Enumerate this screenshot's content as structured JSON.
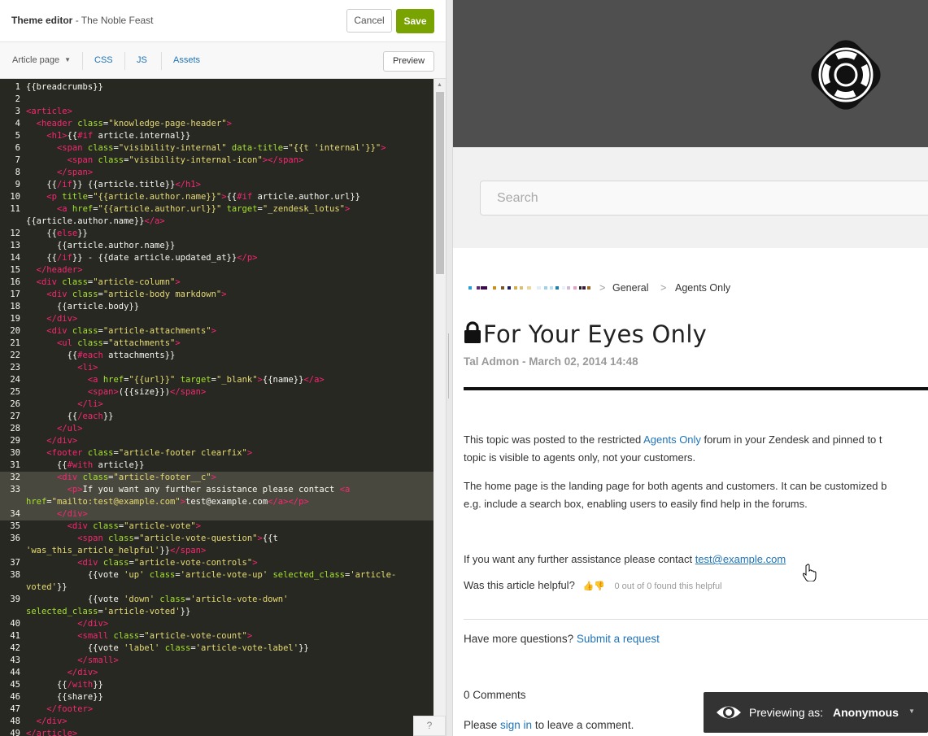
{
  "editor": {
    "title": "Theme editor",
    "subtitle": " - The Noble Feast",
    "cancel_label": "Cancel",
    "save_label": "Save",
    "save_color": "#78a300",
    "page_selector": "Article page",
    "tabs": [
      "CSS",
      "JS",
      "Assets"
    ],
    "preview_label": "Preview",
    "help_label": "?",
    "code_lines": [
      {
        "n": "1",
        "html": "<span class='v'>{{breadcrumbs}}</span>"
      },
      {
        "n": "2",
        "html": ""
      },
      {
        "n": "3",
        "html": "<span class='t'>&lt;article&gt;</span>"
      },
      {
        "n": "4",
        "html": "  <span class='t'>&lt;header</span> <span class='a'>class</span>=<span class='s'>\"knowledge-page-header\"</span><span class='t'>&gt;</span>"
      },
      {
        "n": "5",
        "html": "    <span class='t'>&lt;h1&gt;</span>{{<span class='t'>#if</span> article.internal}}"
      },
      {
        "n": "6",
        "html": "      <span class='t'>&lt;span</span> <span class='a'>class</span>=<span class='s'>\"visibility-internal\"</span> <span class='a'>data-title</span>=<span class='s'>\"{{t 'internal'}}\"</span><span class='t'>&gt;</span>"
      },
      {
        "n": "7",
        "html": "        <span class='t'>&lt;span</span> <span class='a'>class</span>=<span class='s'>\"visibility-internal-icon\"</span><span class='t'>&gt;&lt;/span&gt;</span>"
      },
      {
        "n": "8",
        "html": "      <span class='t'>&lt;/span&gt;</span>"
      },
      {
        "n": "9",
        "html": "    {{<span class='t'>/if</span>}} {{article.title}}<span class='t'>&lt;/h1&gt;</span>"
      },
      {
        "n": "10",
        "html": "    <span class='t'>&lt;p</span> <span class='a'>title</span>=<span class='s'>\"{{article.author.name}}\"</span><span class='t'>&gt;</span>{{<span class='t'>#if</span> article.author.url}}"
      },
      {
        "n": "11",
        "html": "      <span class='t'>&lt;a</span> <span class='a'>href</span>=<span class='s'>\"{{article.author.url}}\"</span> <span class='a'>target</span>=<span class='s'>\"_zendesk_lotus\"</span><span class='t'>&gt;</span>"
      },
      {
        "n": "",
        "html": "{{article.author.name}}<span class='t'>&lt;/a&gt;</span>"
      },
      {
        "n": "12",
        "html": "    {{<span class='t'>else</span>}}"
      },
      {
        "n": "13",
        "html": "      {{article.author.name}}"
      },
      {
        "n": "14",
        "html": "    {{<span class='t'>/if</span>}} - {{date article.updated_at}}<span class='t'>&lt;/p&gt;</span>"
      },
      {
        "n": "15",
        "html": "  <span class='t'>&lt;/header&gt;</span>"
      },
      {
        "n": "16",
        "html": "  <span class='t'>&lt;div</span> <span class='a'>class</span>=<span class='s'>\"article-column\"</span><span class='t'>&gt;</span>"
      },
      {
        "n": "17",
        "html": "    <span class='t'>&lt;div</span> <span class='a'>class</span>=<span class='s'>\"article-body markdown\"</span><span class='t'>&gt;</span>"
      },
      {
        "n": "18",
        "html": "      {{article.body}}"
      },
      {
        "n": "19",
        "html": "    <span class='t'>&lt;/div&gt;</span>"
      },
      {
        "n": "20",
        "html": "    <span class='t'>&lt;div</span> <span class='a'>class</span>=<span class='s'>\"article-attachments\"</span><span class='t'>&gt;</span>"
      },
      {
        "n": "21",
        "html": "      <span class='t'>&lt;ul</span> <span class='a'>class</span>=<span class='s'>\"attachments\"</span><span class='t'>&gt;</span>"
      },
      {
        "n": "22",
        "html": "        {{<span class='t'>#each</span> attachments}}"
      },
      {
        "n": "23",
        "html": "          <span class='t'>&lt;li&gt;</span>"
      },
      {
        "n": "24",
        "html": "            <span class='t'>&lt;a</span> <span class='a'>href</span>=<span class='s'>\"{{url}}\"</span> <span class='a'>target</span>=<span class='s'>\"_blank\"</span><span class='t'>&gt;</span>{{name}}<span class='t'>&lt;/a&gt;</span>"
      },
      {
        "n": "25",
        "html": "            <span class='t'>&lt;span&gt;</span>({{size}})<span class='t'>&lt;/span&gt;</span>"
      },
      {
        "n": "26",
        "html": "          <span class='t'>&lt;/li&gt;</span>"
      },
      {
        "n": "27",
        "html": "        {{<span class='t'>/each</span>}}"
      },
      {
        "n": "28",
        "html": "      <span class='t'>&lt;/ul&gt;</span>"
      },
      {
        "n": "29",
        "html": "    <span class='t'>&lt;/div&gt;</span>"
      },
      {
        "n": "30",
        "html": "    <span class='t'>&lt;footer</span> <span class='a'>class</span>=<span class='s'>\"article-footer clearfix\"</span><span class='t'>&gt;</span>"
      },
      {
        "n": "31",
        "html": "      {{<span class='t'>#with</span> article}}"
      },
      {
        "n": "32",
        "html": "      <span class='t'>&lt;div</span> <span class='a'>class</span>=<span class='s'>\"article-footer__c\"</span><span class='t'>&gt;</span>",
        "hl": true
      },
      {
        "n": "33",
        "html": "        <span class='t'>&lt;p&gt;</span>If you want any further assistance please contact <span class='t'>&lt;a</span>",
        "hl": true
      },
      {
        "n": "",
        "html": "<span class='a'>href</span>=<span class='s'>\"mailto:test@example.com\"</span><span class='t'>&gt;</span>test@example.com<span class='t'>&lt;/a&gt;&lt;/p&gt;</span>",
        "hl": true
      },
      {
        "n": "34",
        "html": "      <span class='t'>&lt;/div&gt;</span>",
        "hl": true
      },
      {
        "n": "35",
        "html": "        <span class='t'>&lt;div</span> <span class='a'>class</span>=<span class='s'>\"article-vote\"</span><span class='t'>&gt;</span>"
      },
      {
        "n": "36",
        "html": "          <span class='t'>&lt;span</span> <span class='a'>class</span>=<span class='s'>\"article-vote-question\"</span><span class='t'>&gt;</span>{{t"
      },
      {
        "n": "",
        "html": "<span class='s'>'was_this_article_helpful'</span>}}<span class='t'>&lt;/span&gt;</span>"
      },
      {
        "n": "37",
        "html": "          <span class='t'>&lt;div</span> <span class='a'>class</span>=<span class='s'>\"article-vote-controls\"</span><span class='t'>&gt;</span>"
      },
      {
        "n": "38",
        "html": "            {{vote <span class='s'>'up'</span> <span class='a'>class</span>=<span class='s'>'article-vote-up'</span> <span class='a'>selected_class</span>=<span class='s'>'article-</span>"
      },
      {
        "n": "",
        "html": "<span class='s'>voted'</span>}}"
      },
      {
        "n": "39",
        "html": "            {{vote <span class='s'>'down'</span> <span class='a'>class</span>=<span class='s'>'article-vote-down'</span>"
      },
      {
        "n": "",
        "html": "<span class='a'>selected_class</span>=<span class='s'>'article-voted'</span>}}"
      },
      {
        "n": "40",
        "html": "          <span class='t'>&lt;/div&gt;</span>"
      },
      {
        "n": "41",
        "html": "          <span class='t'>&lt;small</span> <span class='a'>class</span>=<span class='s'>\"article-vote-count\"</span><span class='t'>&gt;</span>"
      },
      {
        "n": "42",
        "html": "            {{vote <span class='s'>'label'</span> <span class='a'>class</span>=<span class='s'>'article-vote-label'</span>}}"
      },
      {
        "n": "43",
        "html": "          <span class='t'>&lt;/small&gt;</span>"
      },
      {
        "n": "44",
        "html": "        <span class='t'>&lt;/div&gt;</span>"
      },
      {
        "n": "45",
        "html": "      {{<span class='t'>/with</span>}}"
      },
      {
        "n": "46",
        "html": "      {{share}}"
      },
      {
        "n": "47",
        "html": "    <span class='t'>&lt;/footer&gt;</span>"
      },
      {
        "n": "48",
        "html": "  <span class='t'>&lt;/div&gt;</span>"
      },
      {
        "n": "49",
        "html": "<span class='t'>&lt;/article&gt;</span>"
      }
    ]
  },
  "preview": {
    "search_placeholder": "Search",
    "breadcrumb_sep": ">",
    "breadcrumb_general": "General",
    "breadcrumb_agents": "Agents Only",
    "article_title": "For Your Eyes Only",
    "article_meta": "Tal Admon - March 02, 2014 14:48",
    "body_p1_a": "This topic was posted to the restricted ",
    "body_p1_link": "Agents Only",
    "body_p1_b": " forum in your Zendesk and pinned to t",
    "body_p1_c": "topic is visible to agents only, not your customers.",
    "body_p2_a": "The home page is the landing page for both agents and customers. It can be customized b",
    "body_p2_b": "e.g. include a search box, enabling users to easily find help in the forums.",
    "contact_text": "If you want any further assistance please contact ",
    "contact_email": "test@example.com",
    "vote_question": "Was this article helpful?",
    "vote_count": "0 out of 0 found this helpful",
    "more_questions": "Have more questions? ",
    "submit_request": "Submit a request",
    "comments_count": "0 Comments",
    "signin_a": "Please ",
    "signin_link": "sign in",
    "signin_b": " to leave a comment.",
    "previewing_as": "Previewing as:",
    "previewing_user": "Anonymous",
    "link_color": "#1f73b7"
  }
}
